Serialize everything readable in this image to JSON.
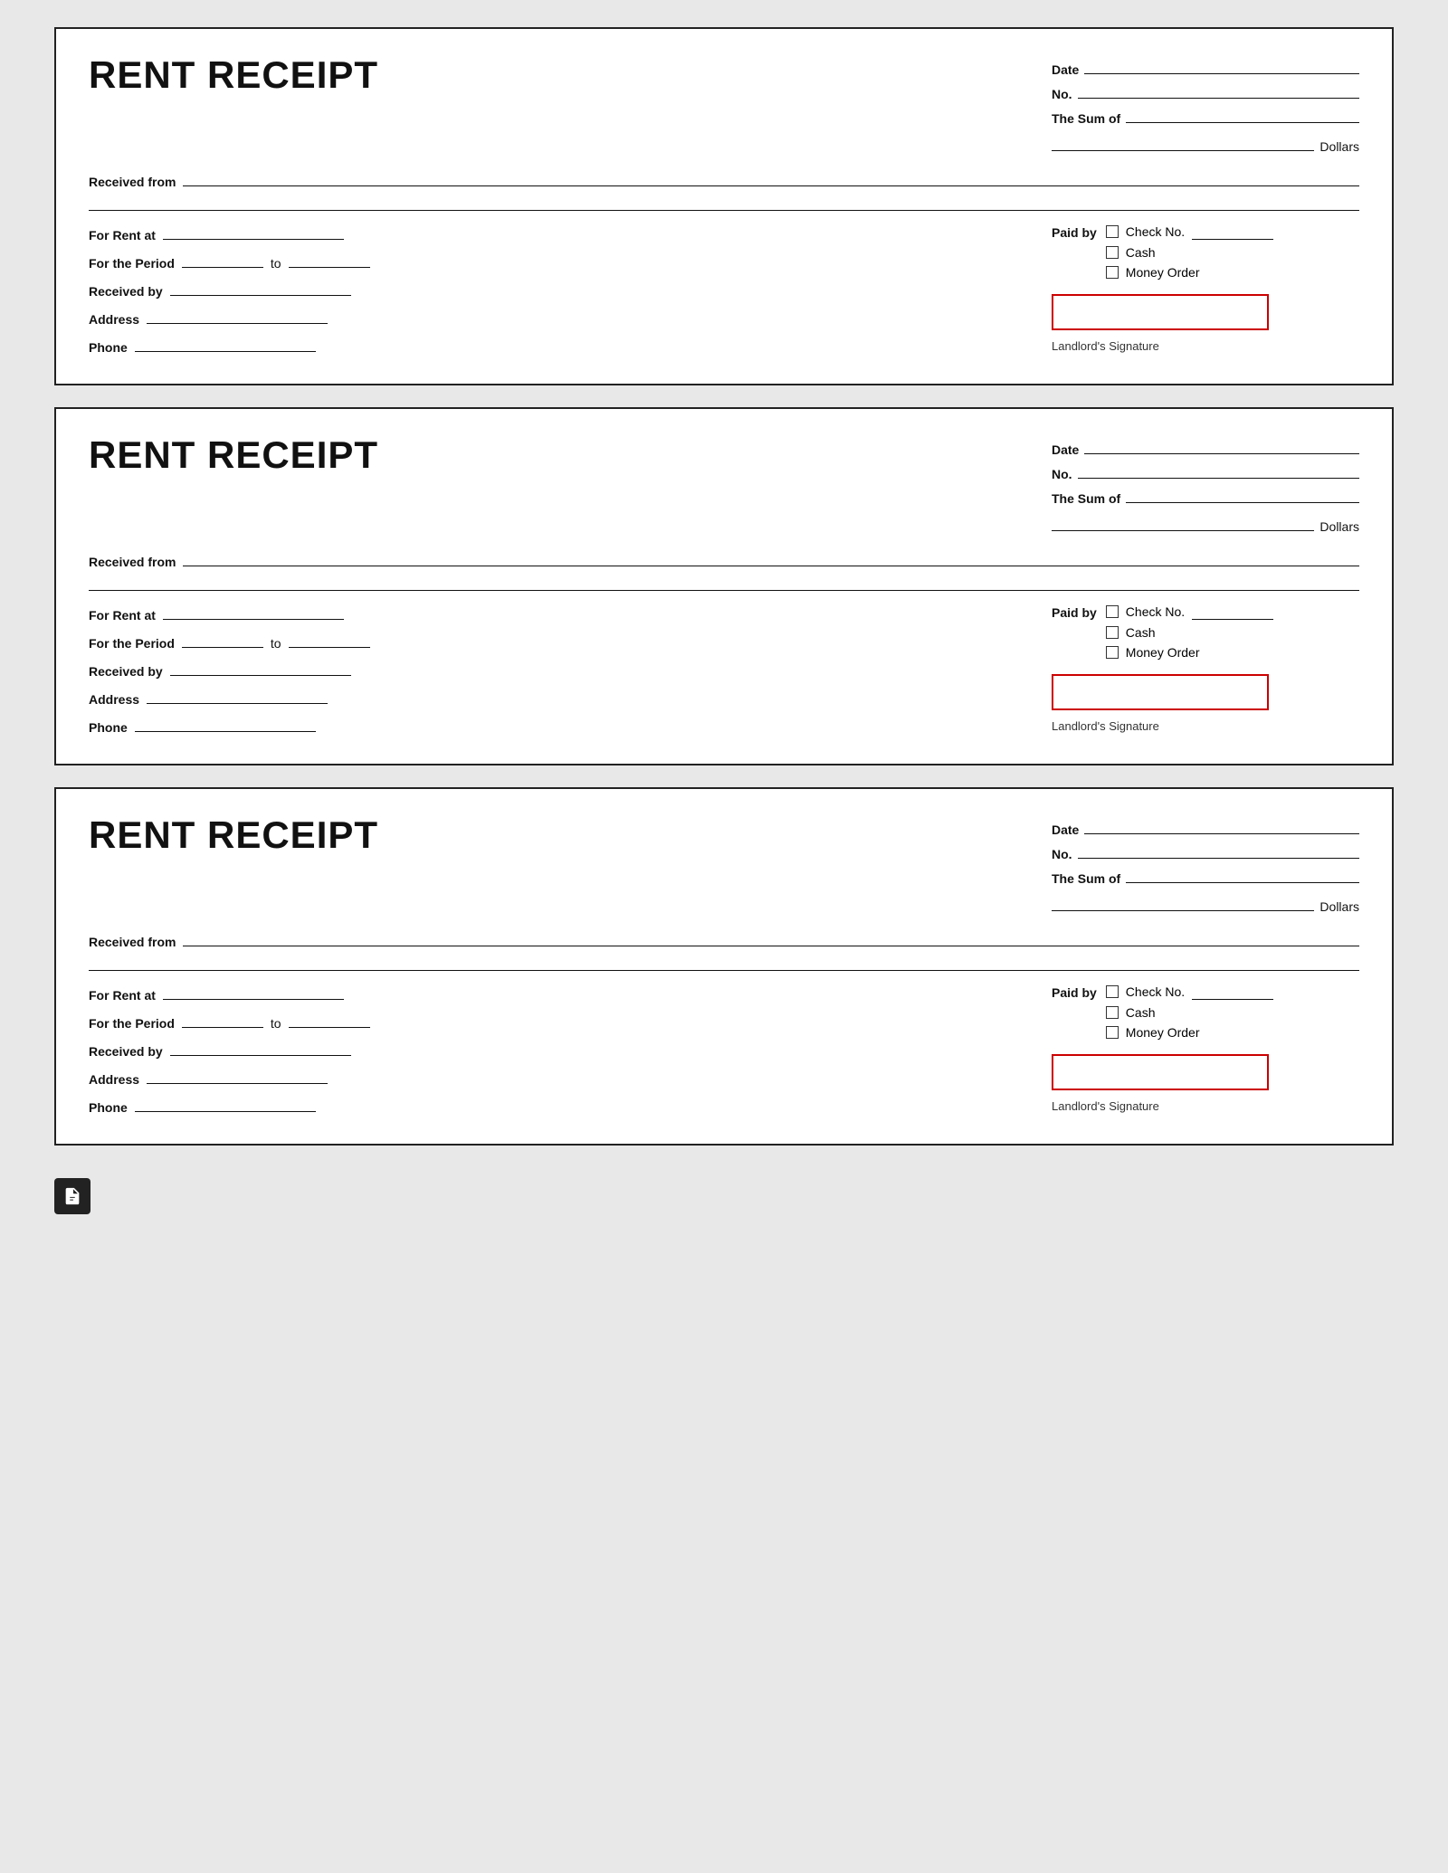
{
  "receipts": [
    {
      "id": 1,
      "title": "RENT RECEIPT",
      "date_label": "Date",
      "no_label": "No.",
      "sum_label": "The Sum of",
      "dollars_label": "Dollars",
      "received_from_label": "Received from",
      "for_rent_label": "For Rent at",
      "period_label": "For the Period",
      "to_label": "to",
      "received_by_label": "Received by",
      "address_label": "Address",
      "phone_label": "Phone",
      "paid_by_label": "Paid by",
      "check_label": "Check No.",
      "cash_label": "Cash",
      "money_order_label": "Money Order",
      "signature_label": "Landlord's Signature"
    },
    {
      "id": 2,
      "title": "RENT RECEIPT",
      "date_label": "Date",
      "no_label": "No.",
      "sum_label": "The Sum of",
      "dollars_label": "Dollars",
      "received_from_label": "Received from",
      "for_rent_label": "For Rent at",
      "period_label": "For the Period",
      "to_label": "to",
      "received_by_label": "Received by",
      "address_label": "Address",
      "phone_label": "Phone",
      "paid_by_label": "Paid by",
      "check_label": "Check No.",
      "cash_label": "Cash",
      "money_order_label": "Money Order",
      "signature_label": "Landlord's Signature"
    },
    {
      "id": 3,
      "title": "RENT RECEIPT",
      "date_label": "Date",
      "no_label": "No.",
      "sum_label": "The Sum of",
      "dollars_label": "Dollars",
      "received_from_label": "Received from",
      "for_rent_label": "For Rent at",
      "period_label": "For the Period",
      "to_label": "to",
      "received_by_label": "Received by",
      "address_label": "Address",
      "phone_label": "Phone",
      "paid_by_label": "Paid by",
      "check_label": "Check No.",
      "cash_label": "Cash",
      "money_order_label": "Money Order",
      "signature_label": "Landlord's Signature"
    }
  ],
  "footer": {
    "icon": "e"
  }
}
